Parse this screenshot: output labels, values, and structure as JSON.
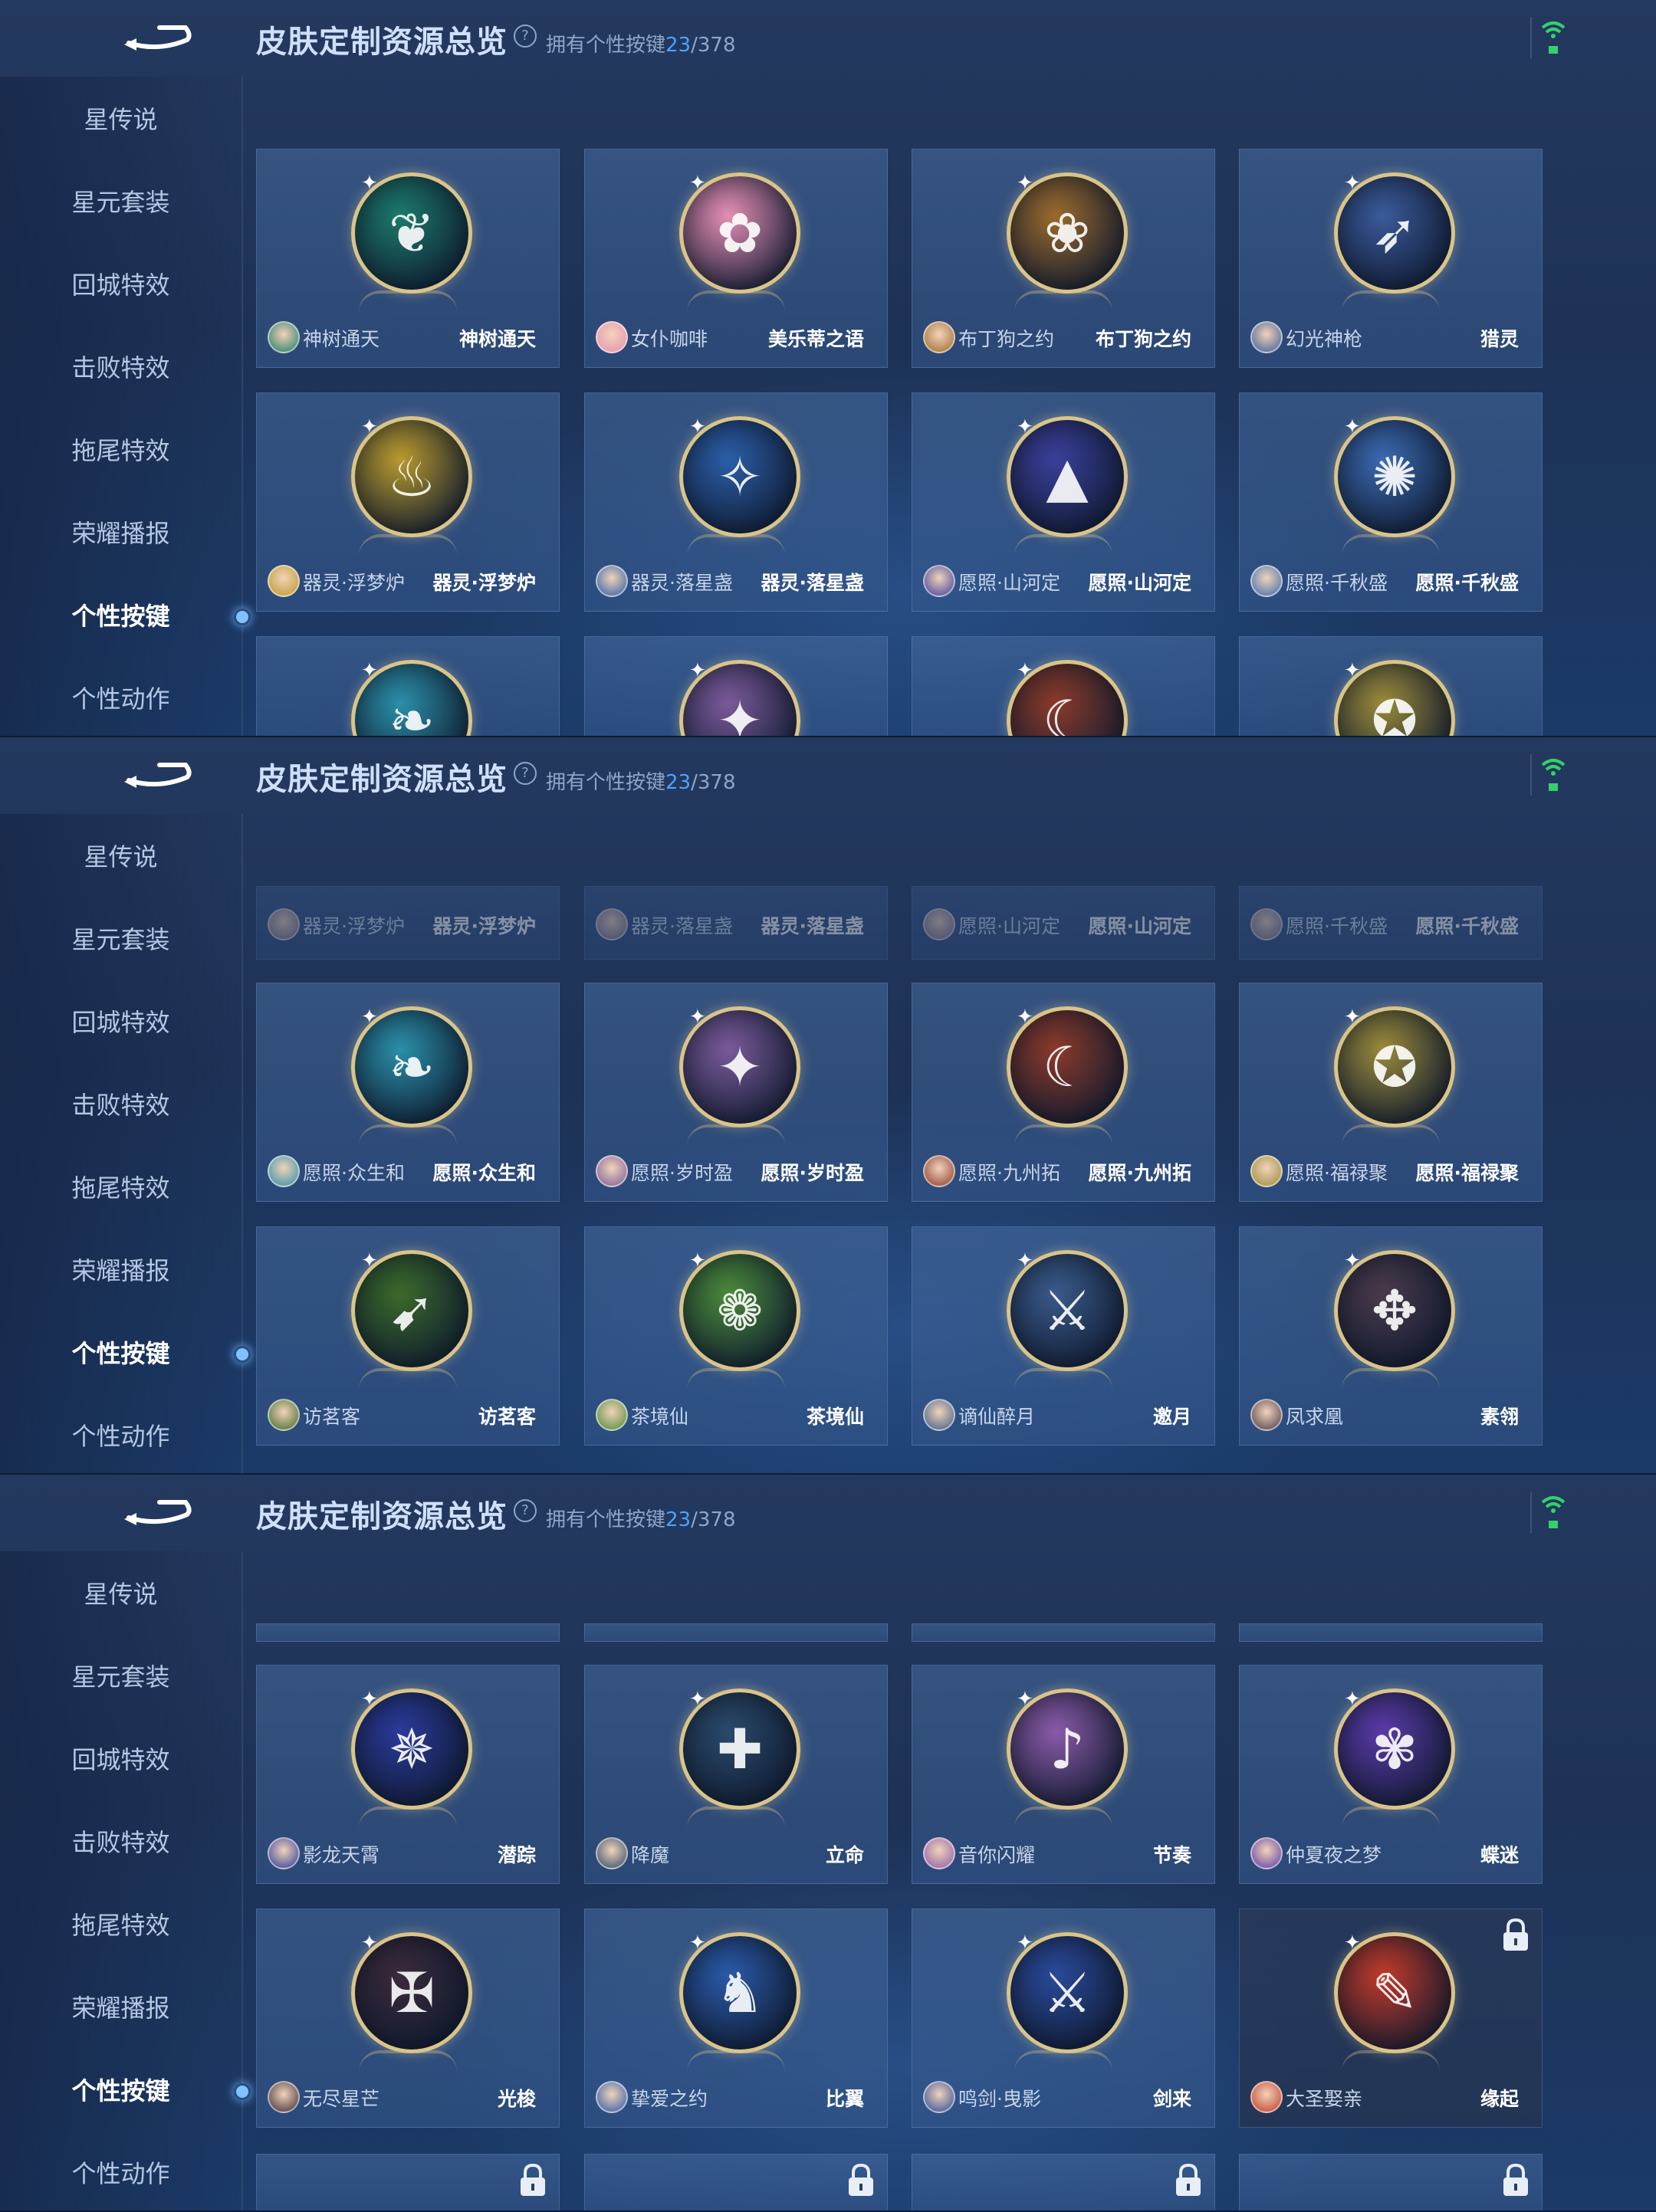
{
  "header": {
    "title": "皮肤定制资源总览",
    "help_glyph": "?",
    "count_prefix": "拥有个性按键",
    "owned": "23",
    "total": "/378"
  },
  "sidebar": {
    "items": [
      {
        "label": "星传说"
      },
      {
        "label": "星元套装"
      },
      {
        "label": "回城特效"
      },
      {
        "label": "击败特效"
      },
      {
        "label": "拖尾特效"
      },
      {
        "label": "荣耀播报"
      },
      {
        "label": "个性按键"
      },
      {
        "label": "个性动作"
      }
    ],
    "active_index": 6
  },
  "colors": {
    "accent_blue": "#4aa3ff",
    "wifi_green": "#35d06a",
    "frame_gold": "#d9c489"
  },
  "panels": [
    {
      "cards": [
        {
          "skin": "神树通天",
          "effect": "神树通天",
          "emblem_color": "#1c7a6a",
          "icon": "leaf-icon"
        },
        {
          "skin": "女仆咖啡",
          "effect": "美乐蒂之语",
          "emblem_color": "#e58fb4",
          "icon": "melody-icon"
        },
        {
          "skin": "布丁狗之约",
          "effect": "布丁狗之约",
          "emblem_color": "#9a6a2c",
          "icon": "ribbon-icon"
        },
        {
          "skin": "幻光神枪",
          "effect": "猎灵",
          "emblem_color": "#3a5a9a",
          "icon": "spear-icon"
        },
        {
          "skin": "器灵·浮梦炉",
          "effect": "器灵·浮梦炉",
          "emblem_color": "#b89a2c",
          "icon": "flame-icon"
        },
        {
          "skin": "器灵·落星盏",
          "effect": "器灵·落星盏",
          "emblem_color": "#2b5ea8",
          "icon": "star-cup-icon"
        },
        {
          "skin": "愿照·山河定",
          "effect": "愿照·山河定",
          "emblem_color": "#3a3f9a",
          "icon": "mountain-icon"
        },
        {
          "skin": "愿照·千秋盛",
          "effect": "愿照·千秋盛",
          "emblem_color": "#3a6ab0",
          "icon": "pinwheel-icon"
        }
      ],
      "peek_cards": [
        "feather-icon",
        "blade-icon",
        "crescent-icon",
        "fish-icon"
      ]
    },
    {
      "top_faded": [
        {
          "skin": "器灵·浮梦炉",
          "effect": "器灵·浮梦炉"
        },
        {
          "skin": "器灵·落星盏",
          "effect": "器灵·落星盏"
        },
        {
          "skin": "愿照·山河定",
          "effect": "愿照·山河定"
        },
        {
          "skin": "愿照·千秋盛",
          "effect": "愿照·千秋盛"
        }
      ],
      "cards": [
        {
          "skin": "愿照·众生和",
          "effect": "愿照·众生和",
          "emblem_color": "#2a8fa8",
          "icon": "feather-icon"
        },
        {
          "skin": "愿照·岁时盈",
          "effect": "愿照·岁时盈",
          "emblem_color": "#7a5a9a",
          "icon": "blade-icon"
        },
        {
          "skin": "愿照·九州拓",
          "effect": "愿照·九州拓",
          "emblem_color": "#8a3a2a",
          "icon": "crescent-icon"
        },
        {
          "skin": "愿照·福禄聚",
          "effect": "愿照·福禄聚",
          "emblem_color": "#9a8a3a",
          "icon": "fish-icon"
        },
        {
          "skin": "访茗客",
          "effect": "访茗客",
          "emblem_color": "#3a6a2a",
          "icon": "arrow-icon"
        },
        {
          "skin": "茶境仙",
          "effect": "茶境仙",
          "emblem_color": "#4a8a3a",
          "icon": "flower-icon"
        },
        {
          "skin": "谪仙醉月",
          "effect": "邀月",
          "emblem_color": "#3a5a8a",
          "icon": "sword-icon"
        },
        {
          "skin": "凤求凰",
          "effect": "素翎",
          "emblem_color": "#4a3a4a",
          "icon": "phoenix-icon"
        }
      ]
    },
    {
      "cards": [
        {
          "skin": "影龙天霄",
          "effect": "潜踪",
          "emblem_color": "#2a3a9a",
          "icon": "dragon-icon"
        },
        {
          "skin": "降魔",
          "effect": "立命",
          "emblem_color": "#2a4a6a",
          "icon": "staff-icon"
        },
        {
          "skin": "音你闪耀",
          "effect": "节奏",
          "emblem_color": "#8a5aa8",
          "icon": "mic-icon"
        },
        {
          "skin": "仲夏夜之梦",
          "effect": "蝶迷",
          "emblem_color": "#5a3aa8",
          "icon": "butterfly-icon"
        },
        {
          "skin": "无尽星芒",
          "effect": "光梭",
          "emblem_color": "#3a2a3a",
          "icon": "mech-icon"
        },
        {
          "skin": "挚爱之约",
          "effect": "比翼",
          "emblem_color": "#2a5aa8",
          "icon": "unicorn-icon"
        },
        {
          "skin": "鸣剑·曳影",
          "effect": "剑来",
          "emblem_color": "#2a4a9a",
          "icon": "sword-icon"
        },
        {
          "skin": "大圣娶亲",
          "effect": "缘起",
          "emblem_color": "#c03a2a",
          "icon": "scroll-icon",
          "locked": true
        }
      ]
    }
  ]
}
